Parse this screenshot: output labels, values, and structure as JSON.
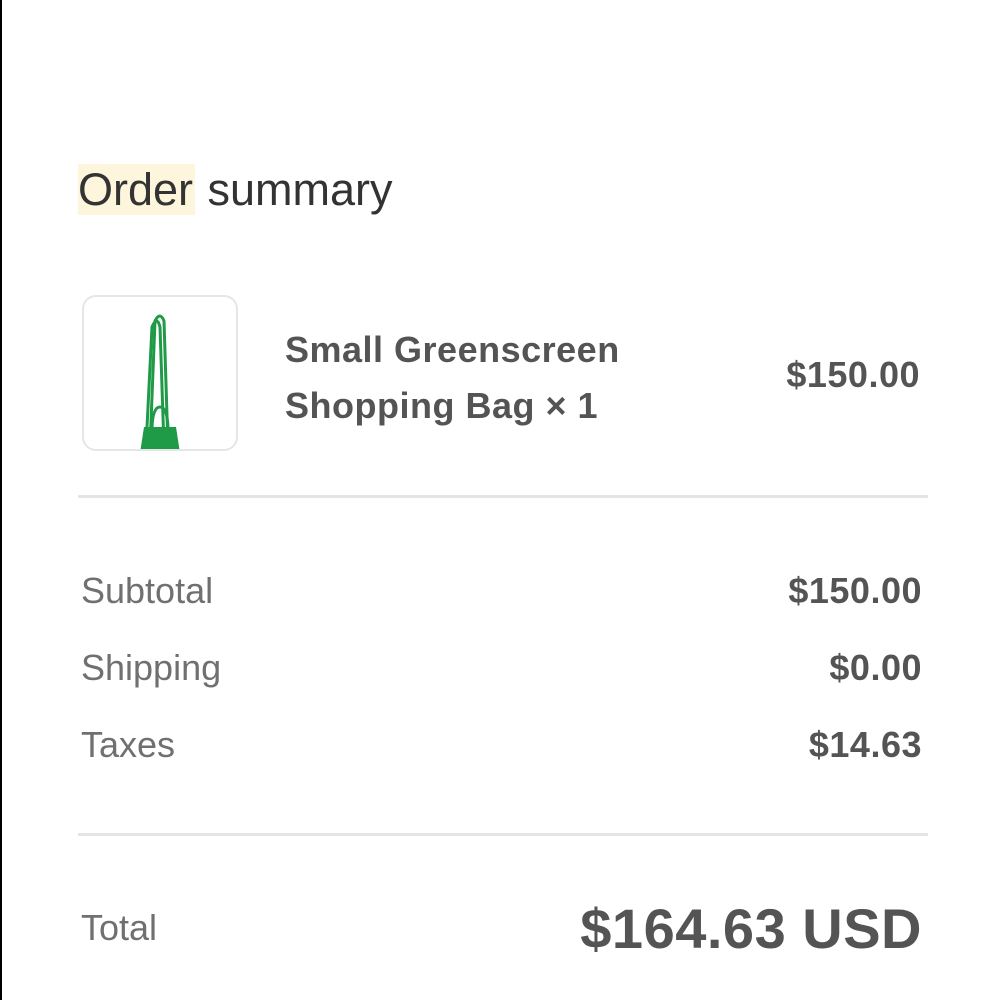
{
  "order_summary": {
    "title_highlighted": "Order",
    "title_rest": " summary",
    "item": {
      "name_line1": "Small Greenscreen",
      "name_line2": "Shopping Bag × 1",
      "price": "$150.00",
      "thumbnail_icon": "green-shopping-bag-icon"
    },
    "subtotal": {
      "label": "Subtotal",
      "value": "$150.00"
    },
    "shipping": {
      "label": "Shipping",
      "value": "$0.00"
    },
    "taxes": {
      "label": "Taxes",
      "value": "$14.63"
    },
    "total": {
      "label": "Total",
      "value": "$164.63 USD"
    }
  },
  "colors": {
    "highlight": "#fdf6dc",
    "bag_green": "#1f9a47",
    "text_dark": "#545454",
    "text_muted": "#707070",
    "divider": "#e4e4e4"
  }
}
